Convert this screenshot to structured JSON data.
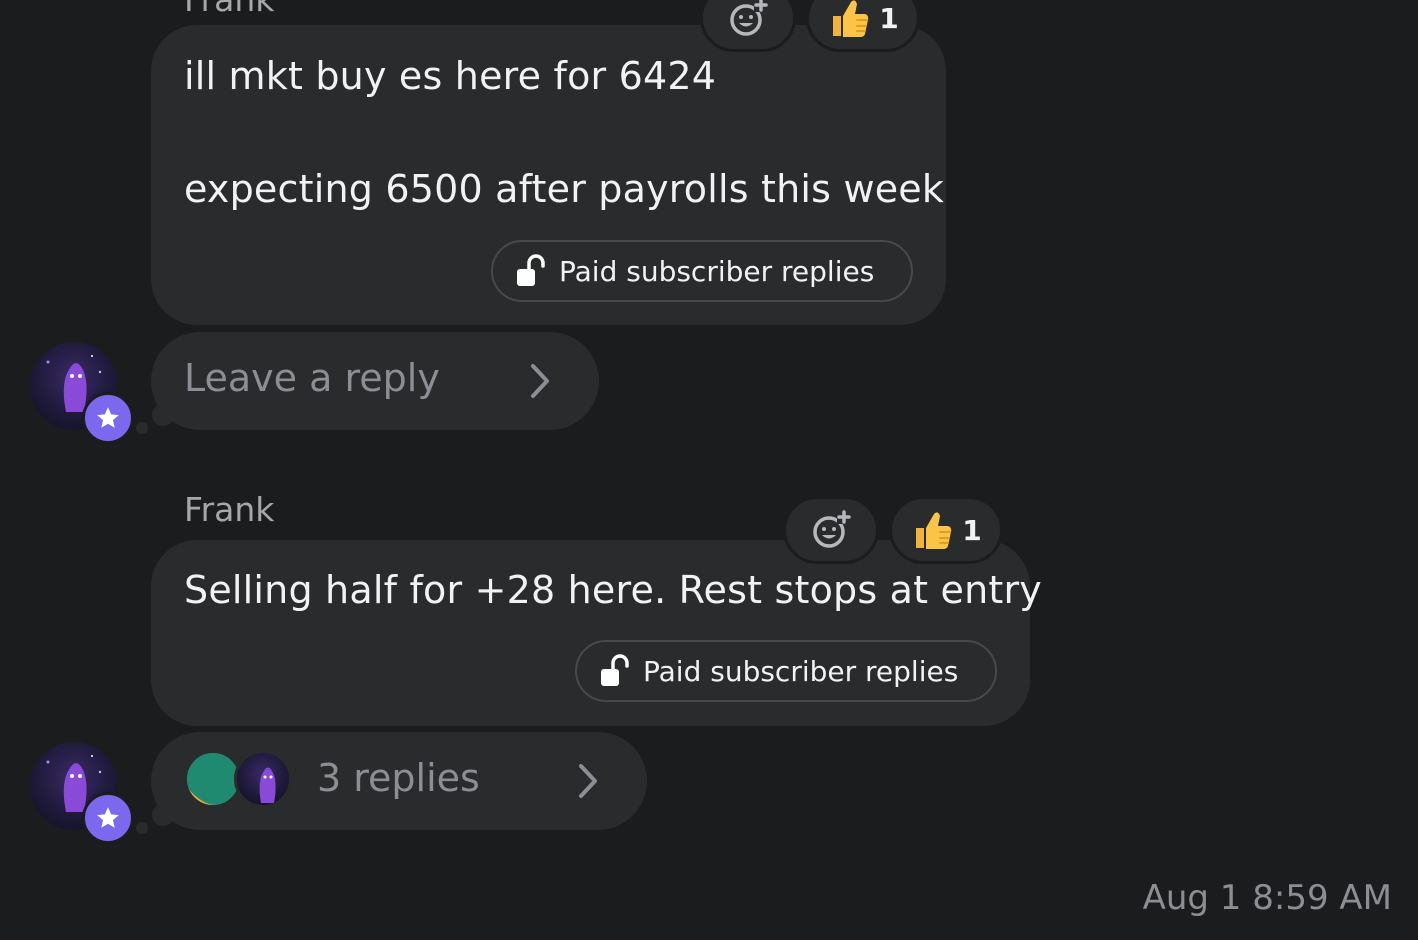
{
  "messages": [
    {
      "sender": "Frank",
      "line1": "ill mkt buy es here for 6424",
      "line2": "expecting 6500 after payrolls this week",
      "paid_label": "Paid subscriber replies",
      "reaction_count": "1",
      "reply_label": "Leave a reply"
    },
    {
      "sender": "Frank",
      "line1": "Selling half for +28 here. Rest stops at entry",
      "paid_label": "Paid subscriber replies",
      "reaction_count": "1",
      "reply_label": "3 replies"
    }
  ],
  "timestamp": "Aug 1 8:59 AM",
  "icons": {
    "add_reaction": "add-reaction-icon",
    "thumbs_up": "thumbs-up-emoji",
    "lock": "unlock-icon",
    "chevron": "chevron-right-icon",
    "star": "star-icon"
  },
  "colors": {
    "background": "#1b1c1e",
    "bubble": "#2a2b2d",
    "badge": "#7b68ee",
    "muted_text": "#8d8e93"
  }
}
